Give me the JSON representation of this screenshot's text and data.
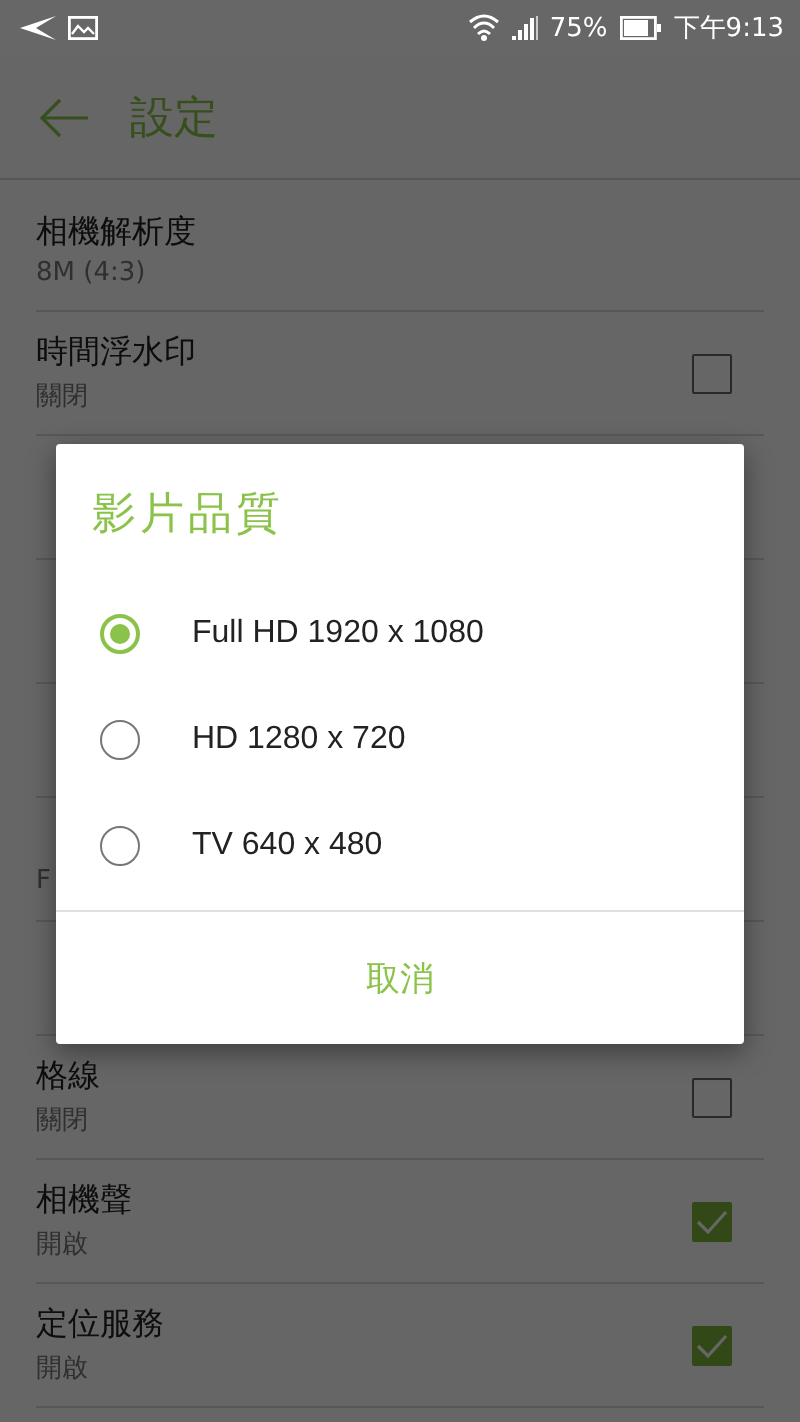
{
  "status_bar": {
    "battery": "75%",
    "time": "下午9:13"
  },
  "toolbar": {
    "title": "設定"
  },
  "settings": [
    {
      "kind": "setting",
      "title": "相機解析度",
      "summary": "8M (4:3)"
    },
    {
      "kind": "check",
      "title": "時間浮水印",
      "summary": "關閉",
      "checked": false
    },
    {
      "kind": "covered"
    },
    {
      "kind": "covered"
    },
    {
      "kind": "covered_header"
    },
    {
      "kind": "setting",
      "summary": "F"
    },
    {
      "kind": "covered_header"
    },
    {
      "kind": "check",
      "title": "格線",
      "summary": "關閉",
      "checked": false
    },
    {
      "kind": "check",
      "title": "相機聲",
      "summary": "開啟",
      "checked": true
    },
    {
      "kind": "check",
      "title": "定位服務",
      "summary": "開啟",
      "checked": true
    }
  ],
  "dialog": {
    "title": "影片品質",
    "options": [
      {
        "label": "Full HD 1920 x 1080",
        "selected": true
      },
      {
        "label": "HD 1280 x 720",
        "selected": false
      },
      {
        "label": "TV 640 x 480",
        "selected": false
      }
    ],
    "cancel": "取消"
  }
}
